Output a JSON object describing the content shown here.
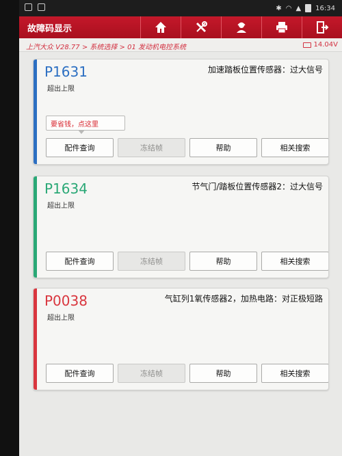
{
  "status_bar": {
    "time": "16:34"
  },
  "header": {
    "title": "故障码显示",
    "tools": [
      {
        "icon": "home-icon"
      },
      {
        "icon": "wrench-screwdriver-icon"
      },
      {
        "icon": "support-person-icon"
      },
      {
        "icon": "printer-icon"
      },
      {
        "icon": "exit-icon"
      }
    ]
  },
  "breadcrumb": {
    "text": "上汽大众 V28.77 > 系统选择 > 01 发动机电控系统",
    "voltage": "14.04V"
  },
  "colors": {
    "header_red": "#c4182a",
    "blue": "#2c6fc2",
    "green": "#2aa876",
    "red": "#d9363e"
  },
  "cards": [
    {
      "code": "P1631",
      "status": "超出上限",
      "description": "加速踏板位置传感器：过大信号",
      "tip": "要省钱，点这里"
    },
    {
      "code": "P1634",
      "status": "超出上限",
      "description": "节气门/踏板位置传感器2：过大信号"
    },
    {
      "code": "P0038",
      "status": "超出上限",
      "description": "气缸列1氧传感器2，加热电路：对正极短路"
    }
  ],
  "buttons": {
    "parts": "配件查询",
    "freeze": "冻结帧",
    "help": "帮助",
    "related": "相关搜索"
  }
}
